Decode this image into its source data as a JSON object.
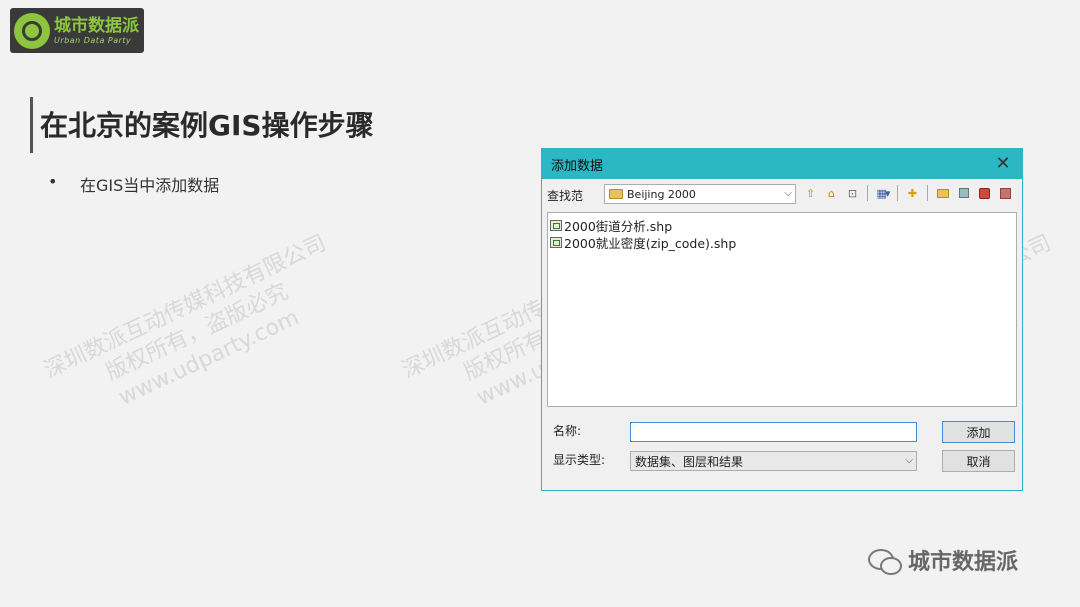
{
  "logo": {
    "cn": "城市数据派",
    "en": "Urban Data Party"
  },
  "slide": {
    "title": "在北京的案例GIS操作步骤",
    "bullet_marker": "•",
    "bullet_text": "在GIS当中添加数据"
  },
  "watermark": {
    "line1": "深圳数派互动传媒科技有限公司",
    "line2": "版权所有，盗版必究",
    "line3": "www.udparty.com"
  },
  "dialog": {
    "title": "添加数据",
    "close": "✕",
    "lookin_label": "查找范",
    "lookin_value": "Beijing 2000",
    "files": [
      {
        "name": "2000街道分析.shp"
      },
      {
        "name": "2000就业密度(zip_code).shp"
      }
    ],
    "name_label": "名称:",
    "name_value": "",
    "type_label": "显示类型:",
    "type_value": "数据集、图层和结果",
    "add_button": "添加",
    "cancel_button": "取消"
  },
  "footer": {
    "text": "城市数据派"
  }
}
